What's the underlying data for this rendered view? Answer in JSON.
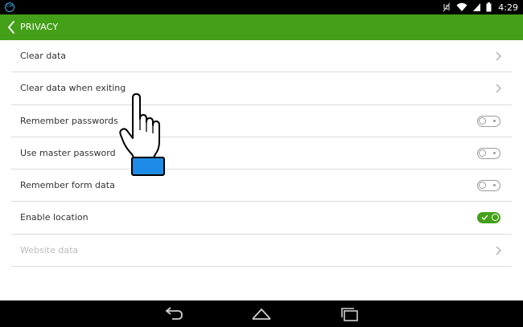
{
  "status_bar": {
    "app_icon": "browser-notification-icon",
    "app_icon_text": "CM",
    "time": "4:29",
    "icons": [
      "muted-icon",
      "wifi-icon",
      "signal-icon",
      "battery-icon"
    ]
  },
  "app_bar": {
    "title": "PRIVACY",
    "color": "#43a018"
  },
  "settings": [
    {
      "label": "Clear data",
      "control": "chevron"
    },
    {
      "label": "Clear data when exiting",
      "control": "chevron"
    },
    {
      "label": "Remember passwords",
      "control": "toggle",
      "checked": false
    },
    {
      "label": "Use master password",
      "control": "toggle",
      "checked": false
    },
    {
      "label": "Remember form data",
      "control": "toggle",
      "checked": false
    },
    {
      "label": "Enable location",
      "control": "toggle",
      "checked": true
    },
    {
      "label": "Website data",
      "control": "chevron",
      "disabled": true
    }
  ],
  "nav_bar": {
    "buttons": [
      "back-icon",
      "home-icon",
      "recent-apps-icon"
    ]
  },
  "overlay": {
    "cursor": "pointing-hand-icon"
  }
}
